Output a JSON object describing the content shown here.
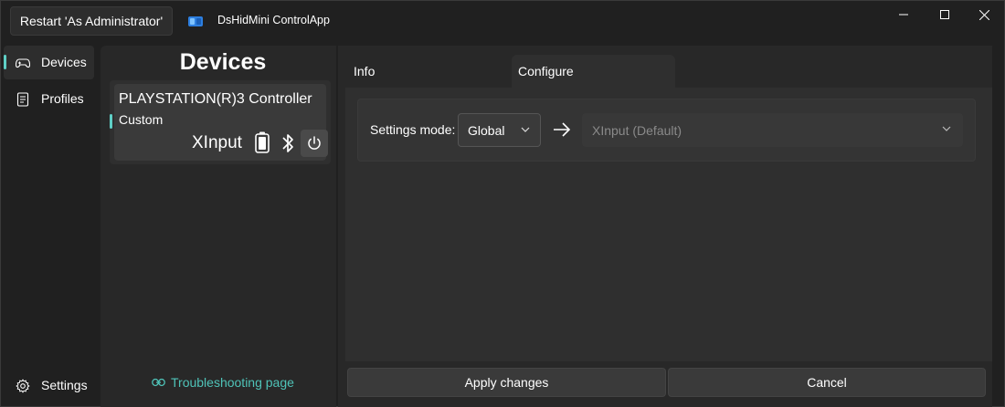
{
  "titlebar": {
    "restart_label": "Restart 'As Administrator'",
    "app_title": "DsHidMini ControlApp",
    "app_icon": "controller-app-icon"
  },
  "nav": {
    "items": [
      {
        "label": "Devices",
        "icon": "gamepad-icon",
        "selected": true
      },
      {
        "label": "Profiles",
        "icon": "document-icon",
        "selected": false
      }
    ],
    "settings": {
      "label": "Settings",
      "icon": "gear-icon"
    }
  },
  "devices": {
    "heading": "Devices",
    "list": [
      {
        "name": "PLAYSTATION(R)3 Controller",
        "profile": "Custom",
        "mode": "XInput",
        "icons": [
          "battery-full-icon",
          "bluetooth-icon",
          "power-icon"
        ]
      }
    ],
    "troubleshooting_link": "Troubleshooting page"
  },
  "tabs": [
    {
      "label": "Info",
      "selected": false
    },
    {
      "label": "Configure",
      "selected": true
    }
  ],
  "configure": {
    "settings_mode_label": "Settings mode:",
    "settings_mode_value": "Global",
    "profile_placeholder": "XInput (Default)"
  },
  "actions": {
    "apply_label": "Apply changes",
    "cancel_label": "Cancel"
  },
  "colors": {
    "accent": "#5fd0c6",
    "link": "#4fc3b8",
    "background": "#202020"
  }
}
